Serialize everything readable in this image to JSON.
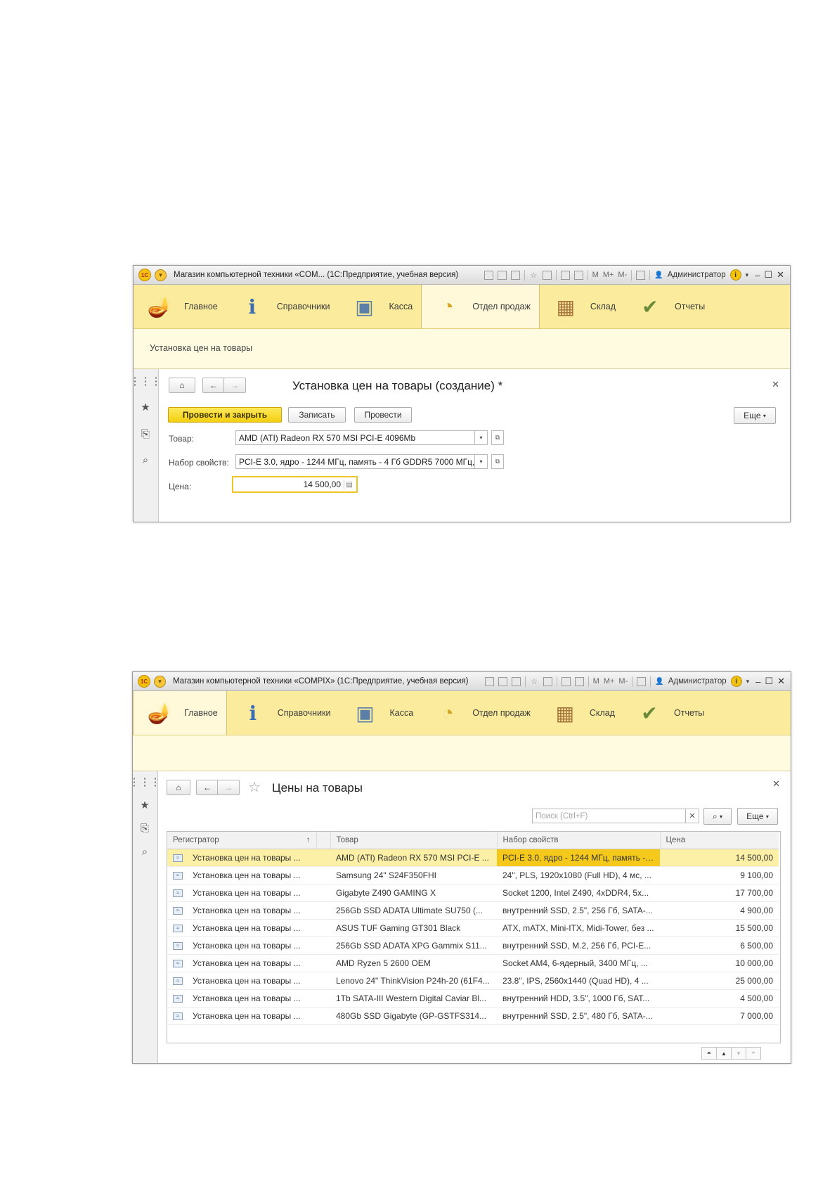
{
  "window1": {
    "title": "Магазин компьютерной техники «COM... (1С:Предприятие, учебная версия)",
    "toolbar": {
      "m": "M",
      "mplus": "M+",
      "mminus": "M-",
      "user": "Администратор",
      "info": "i"
    },
    "sections": [
      {
        "label": "Главное",
        "icon": "desk-lamp-icon"
      },
      {
        "label": "Справочники",
        "icon": "info-book-icon"
      },
      {
        "label": "Касса",
        "icon": "cash-register-icon"
      },
      {
        "label": "Отдел продаж",
        "icon": "coins-chart-icon"
      },
      {
        "label": "Склад",
        "icon": "boxes-cart-icon"
      },
      {
        "label": "Отчеты",
        "icon": "clipboard-icon"
      }
    ],
    "active_section": "Отдел продаж",
    "subpanel_link": "Установка цен на товары",
    "form": {
      "title": "Установка цен на товары (создание) *",
      "buttons": {
        "post_close": "Провести и закрыть",
        "save": "Записать",
        "post": "Провести",
        "more": "Еще"
      },
      "fields": {
        "product_label": "Товар:",
        "product_value": "AMD (ATI) Radeon RX 570 MSI PCI-E 4096Mb",
        "props_label": "Набор свойств:",
        "props_value": "PCI-E 3.0, ядро - 1244 МГц, память - 4 Гб GDDR5 7000 МГц,",
        "price_label": "Цена:",
        "price_value": "14 500,00"
      }
    }
  },
  "window2": {
    "title": "Магазин компьютерной техники «COMPIX» (1С:Предприятие, учебная версия)",
    "toolbar": {
      "m": "M",
      "mplus": "M+",
      "mminus": "M-",
      "user": "Администратор",
      "info": "i"
    },
    "sections": [
      {
        "label": "Главное",
        "icon": "desk-lamp-icon"
      },
      {
        "label": "Справочники",
        "icon": "info-book-icon"
      },
      {
        "label": "Касса",
        "icon": "cash-register-icon"
      },
      {
        "label": "Отдел продаж",
        "icon": "coins-chart-icon"
      },
      {
        "label": "Склад",
        "icon": "boxes-cart-icon"
      },
      {
        "label": "Отчеты",
        "icon": "clipboard-icon"
      }
    ],
    "active_section": "Главное",
    "list": {
      "title": "Цены на товары",
      "search_placeholder": "Поиск (Ctrl+F)",
      "more": "Еще",
      "columns": [
        "Регистратор",
        "Товар",
        "Набор свойств",
        "Цена"
      ],
      "sort_indicator": "↑",
      "rows": [
        {
          "registrar": "Установка цен на товары ...",
          "product": "AMD (ATI) Radeon RX 570 MSI PCI-E ...",
          "props": "PCI-E 3.0, ядро - 1244 МГц, память - ...",
          "price": "14 500,00"
        },
        {
          "registrar": "Установка цен на товары ...",
          "product": "Samsung 24\" S24F350FHI",
          "props": "24\", PLS, 1920x1080 (Full HD), 4 мс, ...",
          "price": "9 100,00"
        },
        {
          "registrar": "Установка цен на товары ...",
          "product": "Gigabyte Z490 GAMING X",
          "props": "Socket 1200, Intel Z490, 4xDDR4, 5x...",
          "price": "17 700,00"
        },
        {
          "registrar": "Установка цен на товары ...",
          "product": "256Gb SSD ADATA Ultimate SU750 (...",
          "props": "внутренний SSD, 2.5\", 256 Гб, SATA-...",
          "price": "4 900,00"
        },
        {
          "registrar": "Установка цен на товары ...",
          "product": "ASUS TUF Gaming GT301 Black",
          "props": "ATX, mATX, Mini-ITX, Midi-Tower, без ...",
          "price": "15 500,00"
        },
        {
          "registrar": "Установка цен на товары ...",
          "product": "256Gb SSD ADATA XPG Gammix S11...",
          "props": "внутренний SSD, M.2, 256 Гб, PCI-E...",
          "price": "6 500,00"
        },
        {
          "registrar": "Установка цен на товары ...",
          "product": "AMD Ryzen 5 2600 OEM",
          "props": "Socket AM4, 6-ядерный, 3400 МГц, ...",
          "price": "10 000,00"
        },
        {
          "registrar": "Установка цен на товары ...",
          "product": "Lenovo 24\" ThinkVision P24h-20 (61F4...",
          "props": "23.8\", IPS, 2560x1440 (Quad HD), 4 ...",
          "price": "25 000,00"
        },
        {
          "registrar": "Установка цен на товары ...",
          "product": "1Tb SATA-III Western Digital Caviar Bl...",
          "props": "внутренний HDD, 3.5\", 1000 Гб, SAT...",
          "price": "4 500,00"
        },
        {
          "registrar": "Установка цен на товары ...",
          "product": "480Gb SSD Gigabyte (GP-GSTFS314...",
          "props": "внутренний SSD, 2.5\", 480 Гб, SATA-...",
          "price": "7 000,00"
        }
      ]
    }
  },
  "colors": {
    "section_bar": "#fbeb9d",
    "primary_button": "#f3cf10",
    "selected_row": "#fcefa6",
    "selected_cell": "#f5c91b"
  }
}
